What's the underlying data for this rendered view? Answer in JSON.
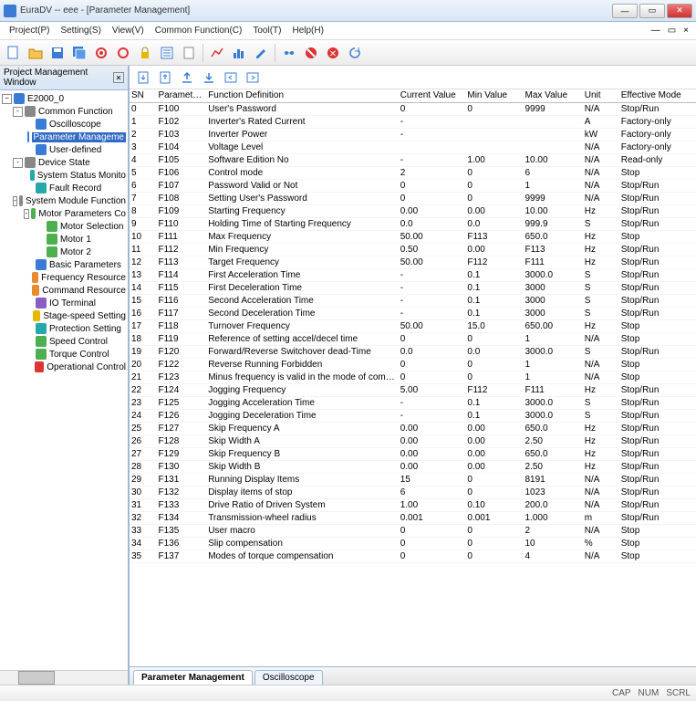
{
  "window": {
    "title": "EuraDV -- eee - [Parameter Management]"
  },
  "menus": [
    "Project(P)",
    "Setting(S)",
    "View(V)",
    "Common Function(C)",
    "Tool(T)",
    "Help(H)"
  ],
  "mdi_close": "×",
  "sidebar": {
    "title": "Project Management Window",
    "root": "E2000_0",
    "nodes": [
      {
        "d": 1,
        "exp": "-",
        "ic": "c-gray",
        "lbl": "Common Function"
      },
      {
        "d": 2,
        "exp": "",
        "ic": "c-blue",
        "lbl": "Oscilloscope"
      },
      {
        "d": 2,
        "exp": "",
        "ic": "c-blue",
        "lbl": "Parameter Manageme",
        "sel": true
      },
      {
        "d": 2,
        "exp": "",
        "ic": "c-blue",
        "lbl": "User-defined"
      },
      {
        "d": 1,
        "exp": "-",
        "ic": "c-gray",
        "lbl": "Device State"
      },
      {
        "d": 2,
        "exp": "",
        "ic": "c-cyan",
        "lbl": "System Status Monito"
      },
      {
        "d": 2,
        "exp": "",
        "ic": "c-cyan",
        "lbl": "Fault Record"
      },
      {
        "d": 1,
        "exp": "-",
        "ic": "c-gray",
        "lbl": "System Module Function"
      },
      {
        "d": 2,
        "exp": "-",
        "ic": "c-green",
        "lbl": "Motor Parameters Co"
      },
      {
        "d": 3,
        "exp": "",
        "ic": "c-green",
        "lbl": "Motor Selection"
      },
      {
        "d": 3,
        "exp": "",
        "ic": "c-green",
        "lbl": "Motor 1"
      },
      {
        "d": 3,
        "exp": "",
        "ic": "c-green",
        "lbl": "Motor 2"
      },
      {
        "d": 2,
        "exp": "",
        "ic": "c-blue",
        "lbl": "Basic Parameters"
      },
      {
        "d": 2,
        "exp": "",
        "ic": "c-org",
        "lbl": "Frequency Resource"
      },
      {
        "d": 2,
        "exp": "",
        "ic": "c-org",
        "lbl": "Command Resource"
      },
      {
        "d": 2,
        "exp": "",
        "ic": "c-pur",
        "lbl": "IO Terminal"
      },
      {
        "d": 2,
        "exp": "",
        "ic": "c-yel",
        "lbl": "Stage-speed Setting"
      },
      {
        "d": 2,
        "exp": "",
        "ic": "c-cyan",
        "lbl": "Protection Setting"
      },
      {
        "d": 2,
        "exp": "",
        "ic": "c-green",
        "lbl": "Speed Control"
      },
      {
        "d": 2,
        "exp": "",
        "ic": "c-green",
        "lbl": "Torque Control"
      },
      {
        "d": 2,
        "exp": "",
        "ic": "c-red",
        "lbl": "Operational Control"
      }
    ]
  },
  "grid": {
    "headers": [
      "SN",
      "Parameters",
      "Function Definition",
      "Current Value",
      "Min Value",
      "Max Value",
      "Unit",
      "Effective Mode"
    ],
    "rows": [
      [
        "0",
        "F100",
        "User's Password",
        "0",
        "0",
        "9999",
        "N/A",
        "Stop/Run"
      ],
      [
        "1",
        "F102",
        "Inverter's Rated Current",
        "-",
        "",
        "",
        "A",
        "Factory-only"
      ],
      [
        "2",
        "F103",
        "Inverter Power",
        "-",
        "",
        "",
        "kW",
        "Factory-only"
      ],
      [
        "3",
        "F104",
        "Voltage Level",
        "",
        "",
        "",
        "N/A",
        "Factory-only"
      ],
      [
        "4",
        "F105",
        "Software Edition No",
        "-",
        "1.00",
        "10.00",
        "N/A",
        "Read-only"
      ],
      [
        "5",
        "F106",
        "Control mode",
        "2",
        "0",
        "6",
        "N/A",
        "Stop"
      ],
      [
        "6",
        "F107",
        "Password Valid or Not",
        "0",
        "0",
        "1",
        "N/A",
        "Stop/Run"
      ],
      [
        "7",
        "F108",
        "Setting User's Password",
        "0",
        "0",
        "9999",
        "N/A",
        "Stop/Run"
      ],
      [
        "8",
        "F109",
        "Starting Frequency",
        "0.00",
        "0.00",
        "10.00",
        "Hz",
        "Stop/Run"
      ],
      [
        "9",
        "F110",
        "Holding Time of Starting Frequency",
        "0.0",
        "0.0",
        "999.9",
        "S",
        "Stop/Run"
      ],
      [
        "10",
        "F111",
        "Max Frequency",
        "50.00",
        "F113",
        "650.0",
        "Hz",
        "Stop"
      ],
      [
        "11",
        "F112",
        "Min Frequency",
        "0.50",
        "0.00",
        "F113",
        "Hz",
        "Stop/Run"
      ],
      [
        "12",
        "F113",
        "Target Frequency",
        "50.00",
        "F112",
        "F111",
        "Hz",
        "Stop/Run"
      ],
      [
        "13",
        "F114",
        "First Acceleration Time",
        "-",
        "0.1",
        "3000.0",
        "S",
        "Stop/Run"
      ],
      [
        "14",
        "F115",
        "First Deceleration Time",
        "-",
        "0.1",
        "3000",
        "S",
        "Stop/Run"
      ],
      [
        "15",
        "F116",
        "Second Acceleration Time",
        "-",
        "0.1",
        "3000",
        "S",
        "Stop/Run"
      ],
      [
        "16",
        "F117",
        "Second Deceleration Time",
        "-",
        "0.1",
        "3000",
        "S",
        "Stop/Run"
      ],
      [
        "17",
        "F118",
        "Turnover Frequency",
        "50.00",
        "15.0",
        "650.00",
        "Hz",
        "Stop"
      ],
      [
        "18",
        "F119",
        "Reference of setting accel/decel time",
        "0",
        "0",
        "1",
        "N/A",
        "Stop"
      ],
      [
        "19",
        "F120",
        "Forward/Reverse Switchover dead-Time",
        "0.0",
        "0.0",
        "3000.0",
        "S",
        "Stop/Run"
      ],
      [
        "20",
        "F122",
        "Reverse Running Forbidden",
        "0",
        "0",
        "1",
        "N/A",
        "Stop"
      ],
      [
        "21",
        "F123",
        "Minus frequency is valid in the mode of combine...",
        "0",
        "0",
        "1",
        "N/A",
        "Stop"
      ],
      [
        "22",
        "F124",
        "Jogging Frequency",
        "5.00",
        "F112",
        "F111",
        "Hz",
        "Stop/Run"
      ],
      [
        "23",
        "F125",
        "Jogging Acceleration Time",
        "-",
        "0.1",
        "3000.0",
        "S",
        "Stop/Run"
      ],
      [
        "24",
        "F126",
        "Jogging Deceleration Time",
        "-",
        "0.1",
        "3000.0",
        "S",
        "Stop/Run"
      ],
      [
        "25",
        "F127",
        "Skip Frequency A",
        "0.00",
        "0.00",
        "650.0",
        "Hz",
        "Stop/Run"
      ],
      [
        "26",
        "F128",
        "Skip Width A",
        "0.00",
        "0.00",
        "2.50",
        "Hz",
        "Stop/Run"
      ],
      [
        "27",
        "F129",
        "Skip Frequency B",
        "0.00",
        "0.00",
        "650.0",
        "Hz",
        "Stop/Run"
      ],
      [
        "28",
        "F130",
        "Skip Width B",
        "0.00",
        "0.00",
        "2.50",
        "Hz",
        "Stop/Run"
      ],
      [
        "29",
        "F131",
        "Running Display Items",
        "15",
        "0",
        "8191",
        "N/A",
        "Stop/Run"
      ],
      [
        "30",
        "F132",
        "Display items of stop",
        "6",
        "0",
        "1023",
        "N/A",
        "Stop/Run"
      ],
      [
        "31",
        "F133",
        "Drive Ratio of Driven System",
        "1.00",
        "0.10",
        "200.0",
        "N/A",
        "Stop/Run"
      ],
      [
        "32",
        "F134",
        "Transmission-wheel radius",
        "0.001",
        "0.001",
        "1.000",
        "m",
        "Stop/Run"
      ],
      [
        "33",
        "F135",
        "User macro",
        "0",
        "0",
        "2",
        "N/A",
        "Stop"
      ],
      [
        "34",
        "F136",
        "Slip compensation",
        "0",
        "0",
        "10",
        "%",
        "Stop"
      ],
      [
        "35",
        "F137",
        "Modes of torque compensation",
        "0",
        "0",
        "4",
        "N/A",
        "Stop"
      ]
    ]
  },
  "tabs": [
    {
      "label": "Parameter Management",
      "active": true
    },
    {
      "label": "Oscilloscope",
      "active": false
    }
  ],
  "status": [
    "CAP",
    "NUM",
    "SCRL"
  ]
}
